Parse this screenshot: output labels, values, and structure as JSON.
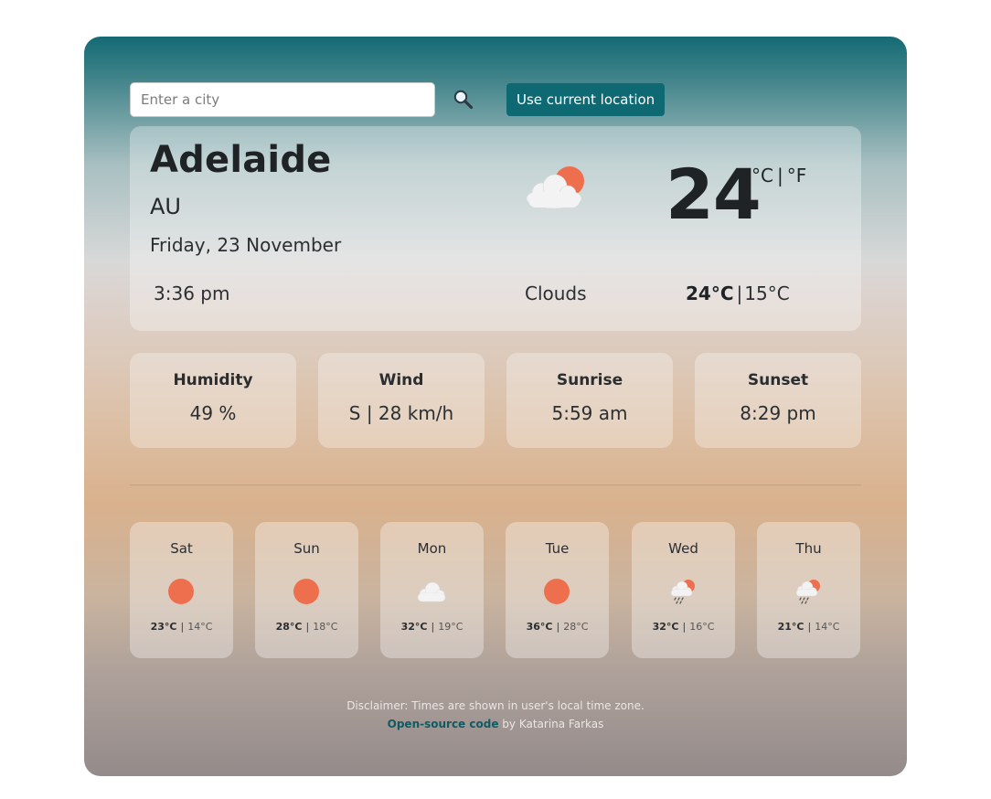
{
  "search": {
    "placeholder": "Enter a city",
    "value": "",
    "search_icon": "magnifier-icon",
    "location_button_label": "Use current location"
  },
  "current": {
    "city": "Adelaide",
    "country": "AU",
    "date": "Friday, 23 November",
    "time": "3:36 pm",
    "icon": "partly-cloudy-icon",
    "condition": "Clouds",
    "temperature": "24",
    "unit_celsius": "°C",
    "unit_separator": "|",
    "unit_fahrenheit": "°F",
    "high": "24°C",
    "low": "15°C",
    "hilo_separator": "|"
  },
  "stats": [
    {
      "label": "Humidity",
      "value": "49 %"
    },
    {
      "label": "Wind",
      "value": "S | 28 km/h"
    },
    {
      "label": "Sunrise",
      "value": "5:59 am"
    },
    {
      "label": "Sunset",
      "value": "8:29 pm"
    }
  ],
  "forecast": [
    {
      "day": "Sat",
      "icon": "sun-icon",
      "high": "23°C",
      "low": "14°C"
    },
    {
      "day": "Sun",
      "icon": "sun-icon",
      "high": "28°C",
      "low": "18°C"
    },
    {
      "day": "Mon",
      "icon": "cloud-icon",
      "high": "32°C",
      "low": "19°C"
    },
    {
      "day": "Tue",
      "icon": "sun-icon",
      "high": "36°C",
      "low": "28°C"
    },
    {
      "day": "Wed",
      "icon": "sun-rain-cloud-icon",
      "high": "32°C",
      "low": "16°C"
    },
    {
      "day": "Thu",
      "icon": "sun-rain-cloud-icon",
      "high": "21°C",
      "low": "14°C"
    }
  ],
  "footer": {
    "disclaimer": "Disclaimer: Times are shown in user's local time zone.",
    "link_text": "Open-source code",
    "credit": " by Katarina Farkas"
  },
  "colors": {
    "accent": "#0f6973",
    "sun": "#ee6f4e",
    "cloud": "#f2f2f2"
  }
}
